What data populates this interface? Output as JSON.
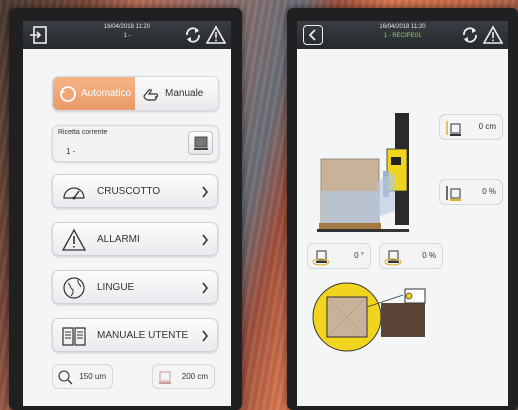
{
  "left_panel": {
    "datetime": "16/04/2018 11:20",
    "recipe_short": "1 -",
    "mode_toggle": {
      "automatic_label": "Automatico",
      "manual_label": "Manuale",
      "active": "automatic"
    },
    "current_recipe": {
      "label": "Ricetta corrente",
      "value": "1 -"
    },
    "menu_items": [
      {
        "label": "CRUSCOTTO",
        "icon": "gauge-icon"
      },
      {
        "label": "ALLARMI",
        "icon": "warning-icon"
      },
      {
        "label": "LINGUE",
        "icon": "globe-icon"
      },
      {
        "label": "MANUALE UTENTE",
        "icon": "book-icon"
      }
    ],
    "bottom_params": [
      {
        "value": "150 um",
        "icon": "film-thickness-icon"
      },
      {
        "value": "200 cm",
        "icon": "pallet-height-icon"
      }
    ]
  },
  "right_panel": {
    "datetime": "16/04/2018 11:20",
    "recipe_title": "1 - RECIPE01",
    "params": {
      "height": "0 cm",
      "percent_top": "0 %",
      "angle": "0 °",
      "percent_bottom": "0 %"
    }
  },
  "colors": {
    "accent_orange": "#f0a878",
    "topbar": "#2e3236",
    "wrapper_yellow": "#f1d41e",
    "recipe_green": "#8fd35a"
  }
}
